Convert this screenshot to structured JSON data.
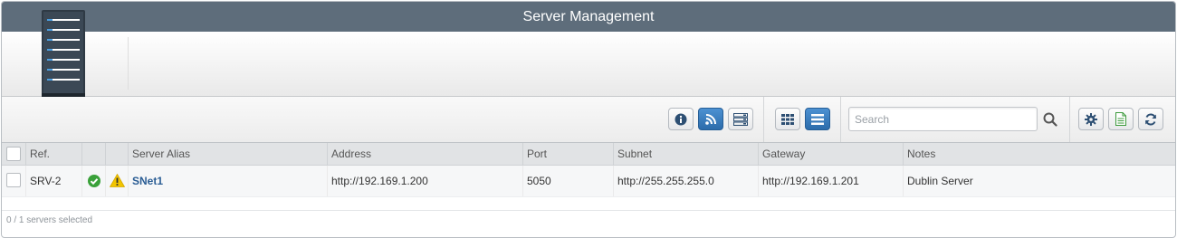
{
  "window": {
    "title": "Server Management"
  },
  "hero": {
    "image": "server-rack-icon"
  },
  "toolbar": {
    "buttons": [
      {
        "name": "info-button",
        "icon": "info-icon",
        "active": false
      },
      {
        "name": "rss-button",
        "icon": "rss-icon",
        "active": true
      },
      {
        "name": "server-list-button",
        "icon": "server-list-icon",
        "active": false
      },
      {
        "name": "grid-view-button",
        "icon": "grid-icon",
        "active": false
      },
      {
        "name": "list-view-button",
        "icon": "list-icon",
        "active": true
      },
      {
        "name": "settings-button",
        "icon": "gear-icon",
        "active": false
      },
      {
        "name": "export-button",
        "icon": "document-icon",
        "active": false
      },
      {
        "name": "refresh-button",
        "icon": "refresh-icon",
        "active": false
      }
    ],
    "search": {
      "placeholder": "Search",
      "value": ""
    }
  },
  "table": {
    "columns": [
      "Ref.",
      "Server Alias",
      "Address",
      "Port",
      "Subnet",
      "Gateway",
      "Notes"
    ],
    "rows": [
      {
        "selected": false,
        "ref": "SRV-2",
        "status_ok_icon": "check-circle-icon",
        "warning_icon": "warning-icon",
        "alias": "SNet1",
        "address": "http://192.169.1.200",
        "port": "5050",
        "subnet": "http://255.255.255.0",
        "gateway": "http://192.169.1.201",
        "notes": "Dublin Server"
      }
    ]
  },
  "footer": {
    "status": "0 / 1 servers selected"
  },
  "colors": {
    "titlebar": "#5e6d7b",
    "accent": "#3a7fc1",
    "link": "#2a5d94",
    "ok": "#3aa13a",
    "warning": "#f2c500"
  }
}
